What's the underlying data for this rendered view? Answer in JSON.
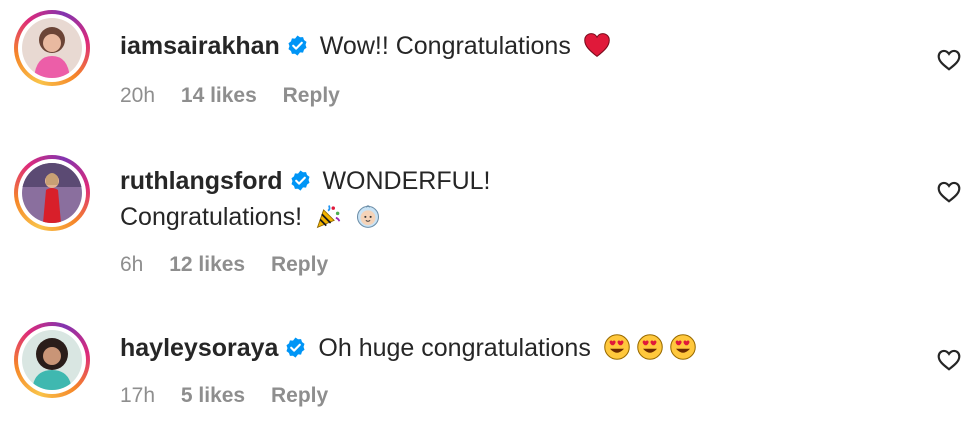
{
  "comments": [
    {
      "username": "iamsairakhan",
      "text": "Wow!! Congratulations",
      "emojis": [
        "red-heart"
      ],
      "time": "20h",
      "likes": "14 likes",
      "reply": "Reply"
    },
    {
      "username": "ruthlangsford",
      "text_line1": "WONDERFUL!",
      "text_line2": "Congratulations!",
      "emojis": [
        "party-popper",
        "baby"
      ],
      "time": "6h",
      "likes": "12 likes",
      "reply": "Reply"
    },
    {
      "username": "hayleysoraya",
      "text": "Oh huge congratulations",
      "emojis": [
        "heart-eyes",
        "heart-eyes",
        "heart-eyes"
      ],
      "time": "17h",
      "likes": "5 likes",
      "reply": "Reply"
    }
  ],
  "colors": {
    "verified": "#0095f6",
    "meta_text": "#8e8e8e",
    "heart": "#e0193a"
  }
}
